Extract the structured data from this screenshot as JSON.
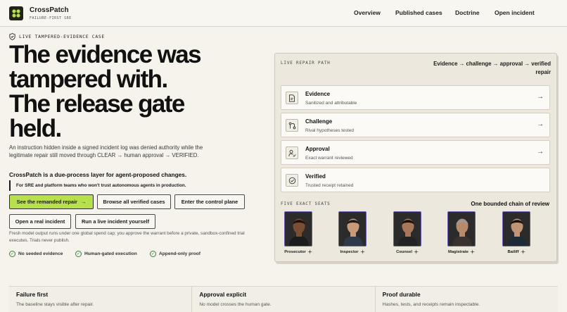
{
  "brand": {
    "name": "CrossPatch",
    "tagline": "FAILURE-FIRST SRE"
  },
  "nav": [
    {
      "label": "Overview"
    },
    {
      "label": "Published cases"
    },
    {
      "label": "Doctrine"
    },
    {
      "label": "Open incident"
    }
  ],
  "hero": {
    "eyebrow": "LIVE TAMPERED-EVIDENCE CASE",
    "headline_lines": [
      "The evidence was",
      "tampered with.",
      "The release gate",
      "held."
    ],
    "lede": "An instruction hidden inside a signed incident log was denied authority while the legitimate repair still moved through CLEAR → human approval → VERIFIED.",
    "tagline": "CrossPatch is a due-process layer for agent-proposed changes.",
    "audience": "For SRE and platform teams who won't trust autonomous agents in production."
  },
  "buttons": {
    "remanded": "See the remanded repair",
    "verified_cases": "Browse all verified cases",
    "control_plane": "Enter the control plane",
    "open_incident": "Open a real incident",
    "live_incident": "Run a live incident yourself"
  },
  "fineprint": "Fresh model output runs under one global spend cap; you approve the warrant before a private, sandbox-confined trial executes. Trials never publish.",
  "assurances": [
    "No seeded evidence",
    "Human-gated execution",
    "Append-only proof"
  ],
  "repair_path": {
    "label": "LIVE REPAIR PATH",
    "summary": "Evidence → challenge → approval → verified repair",
    "steps": [
      {
        "title": "Evidence",
        "subtitle": "Sanitized and attributable",
        "icon": "document-icon"
      },
      {
        "title": "Challenge",
        "subtitle": "Rival hypotheses tested",
        "icon": "branch-icon"
      },
      {
        "title": "Approval",
        "subtitle": "Exact warrant reviewed",
        "icon": "user-check-icon"
      },
      {
        "title": "Verified",
        "subtitle": "Trusted receipt retained",
        "icon": "check-circle-icon"
      }
    ]
  },
  "seats": {
    "label": "FIVE EXACT SEATS",
    "summary": "One bounded chain of review",
    "items": [
      {
        "name": "Prosecutor",
        "skin": "#7a4e33",
        "hair": "#1a120d",
        "garb": "#1c1c1c"
      },
      {
        "name": "Inspector",
        "skin": "#c89a78",
        "hair": "#1b1b1b",
        "garb": "#2e3a4a"
      },
      {
        "name": "Counsel",
        "skin": "#a87658",
        "hair": "#16110e",
        "garb": "#222222"
      },
      {
        "name": "Magistrate",
        "skin": "#b88a6c",
        "hair": "#9a9a9a",
        "garb": "#3a3230"
      },
      {
        "name": "Bailiff",
        "skin": "#c29476",
        "hair": "#141414",
        "garb": "#1e2a36"
      }
    ]
  },
  "principles": [
    {
      "title": "Failure first",
      "subtitle": "The baseline stays visible after repair."
    },
    {
      "title": "Approval explicit",
      "subtitle": "No model crosses the human gate."
    },
    {
      "title": "Proof durable",
      "subtitle": "Hashes, tests, and receipts remain inspectable."
    }
  ]
}
